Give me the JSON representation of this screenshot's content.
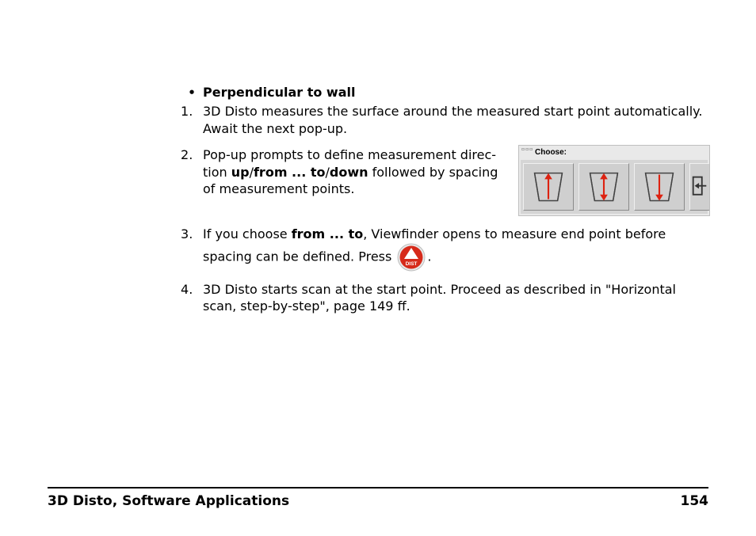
{
  "bullet_heading": "Perpendicular to wall",
  "steps": {
    "s1": "3D Disto measures the surface around the measured start point automatically. Await the next pop-up.",
    "s2_a": "Pop-up prompts to define measurement direc­tion ",
    "s2_b1": "up",
    "s2_slash1": "/",
    "s2_b2": "from ... to",
    "s2_slash2": "/",
    "s2_b3": "down",
    "s2_c": " followed by spacing of measurement points.",
    "s3_a": "If you choose ",
    "s3_b": "from ... to",
    "s3_c": ", Viewfinder opens to measure end point before spacing can be defined. Press ",
    "s3_d": ".",
    "s4": "3D Disto starts scan at the start point. Proceed as described in \"Horizontal scan, step-by-step\", page 149 ff."
  },
  "popup": {
    "title": "Choose:"
  },
  "dist_icon_label": "DIST",
  "footer": {
    "title": "3D Disto, Software Applications",
    "page": "154"
  }
}
